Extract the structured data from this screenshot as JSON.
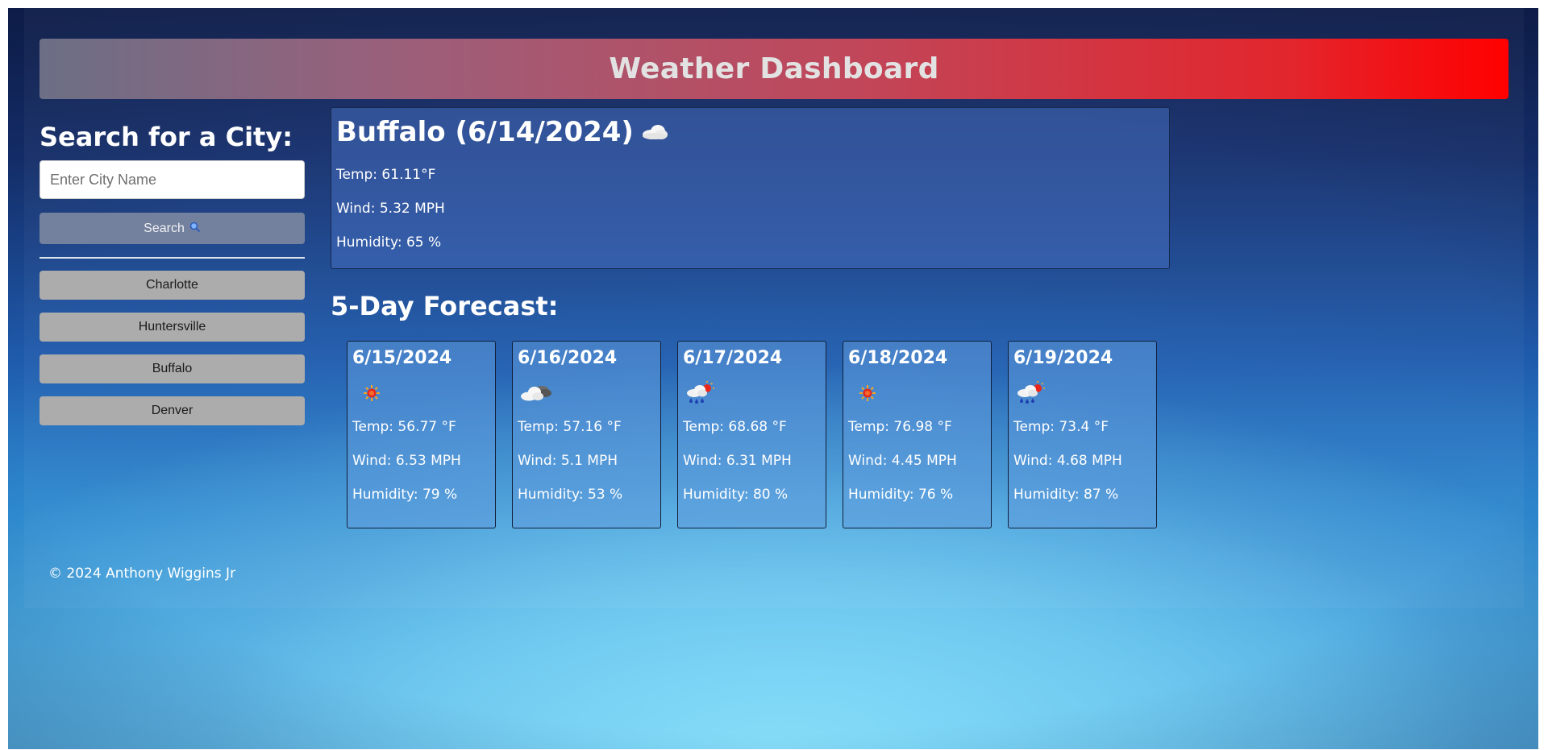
{
  "header": {
    "title": "Weather Dashboard"
  },
  "sidebar": {
    "heading": "Search for a City:",
    "search_placeholder": "Enter City Name",
    "search_button": "Search",
    "search_icon": "magnifier-icon",
    "history": [
      "Charlotte",
      "Huntersville",
      "Buffalo",
      "Denver"
    ]
  },
  "current": {
    "title": "Buffalo (6/14/2024)",
    "icon": "cloud-icon",
    "temp": "Temp: 61.11°F",
    "wind": "Wind: 5.32 MPH",
    "humidity": "Humidity: 65 %"
  },
  "forecast": {
    "heading": "5-Day Forecast:",
    "days": [
      {
        "date": "6/15/2024",
        "icon": "sun-icon",
        "temp": "Temp: 56.77 °F",
        "wind": "Wind: 6.53 MPH",
        "humidity": "Humidity: 79 %"
      },
      {
        "date": "6/16/2024",
        "icon": "clouds-icon",
        "temp": "Temp: 57.16 °F",
        "wind": "Wind: 5.1 MPH",
        "humidity": "Humidity: 53 %"
      },
      {
        "date": "6/17/2024",
        "icon": "rain-sun-icon",
        "temp": "Temp: 68.68 °F",
        "wind": "Wind: 6.31 MPH",
        "humidity": "Humidity: 80 %"
      },
      {
        "date": "6/18/2024",
        "icon": "sun-icon",
        "temp": "Temp: 76.98 °F",
        "wind": "Wind: 4.45 MPH",
        "humidity": "Humidity: 76 %"
      },
      {
        "date": "6/19/2024",
        "icon": "rain-sun-icon",
        "temp": "Temp: 73.4 °F",
        "wind": "Wind: 4.68 MPH",
        "humidity": "Humidity: 87 %"
      }
    ]
  },
  "footer": {
    "text": "© 2024 Anthony Wiggins Jr"
  },
  "colors": {
    "header_start": "#6b6f86",
    "header_end": "#ff0000",
    "search_button": "#73819f",
    "history_button": "#acacac"
  }
}
